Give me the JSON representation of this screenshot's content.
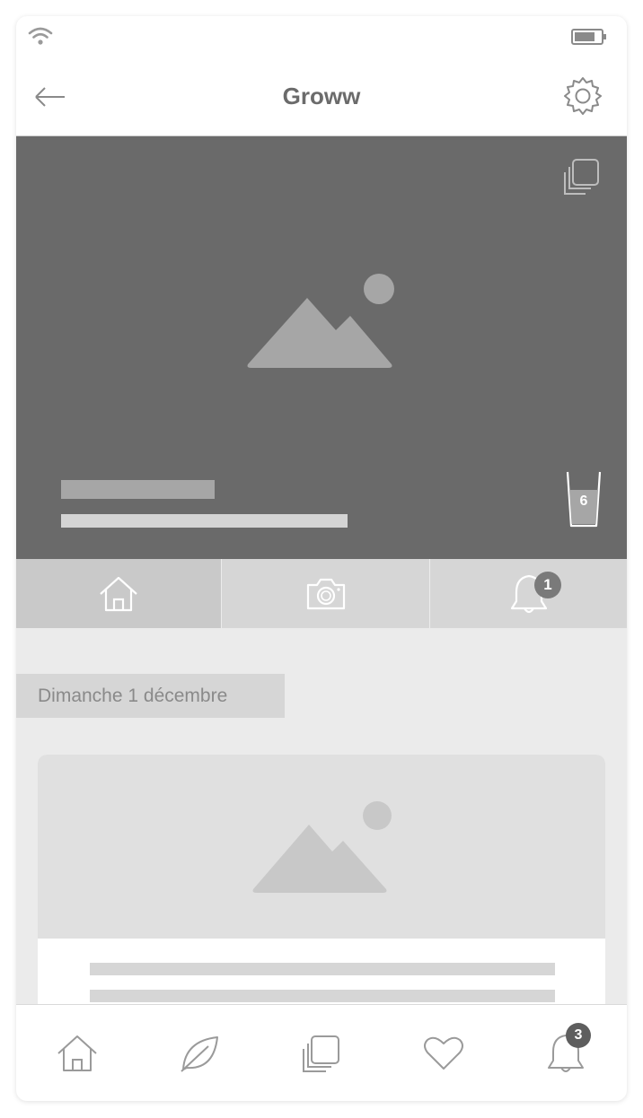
{
  "header": {
    "title": "Groww"
  },
  "hero": {
    "glass_count": "6"
  },
  "tabs": [
    {
      "icon": "home-icon",
      "active": true
    },
    {
      "icon": "camera-icon",
      "active": false
    },
    {
      "icon": "bell-icon",
      "active": false,
      "badge": "1"
    }
  ],
  "feed": {
    "date_label": "Dimanche 1 décembre"
  },
  "bottom_nav": {
    "items": [
      {
        "icon": "home-icon"
      },
      {
        "icon": "leaf-icon"
      },
      {
        "icon": "gallery-icon"
      },
      {
        "icon": "heart-icon"
      },
      {
        "icon": "bell-icon",
        "badge": "3"
      }
    ]
  },
  "colors": {
    "hero_bg": "#6a6a6a",
    "badge_bg": "#7a7a7a",
    "page_bg": "#ebebeb"
  }
}
